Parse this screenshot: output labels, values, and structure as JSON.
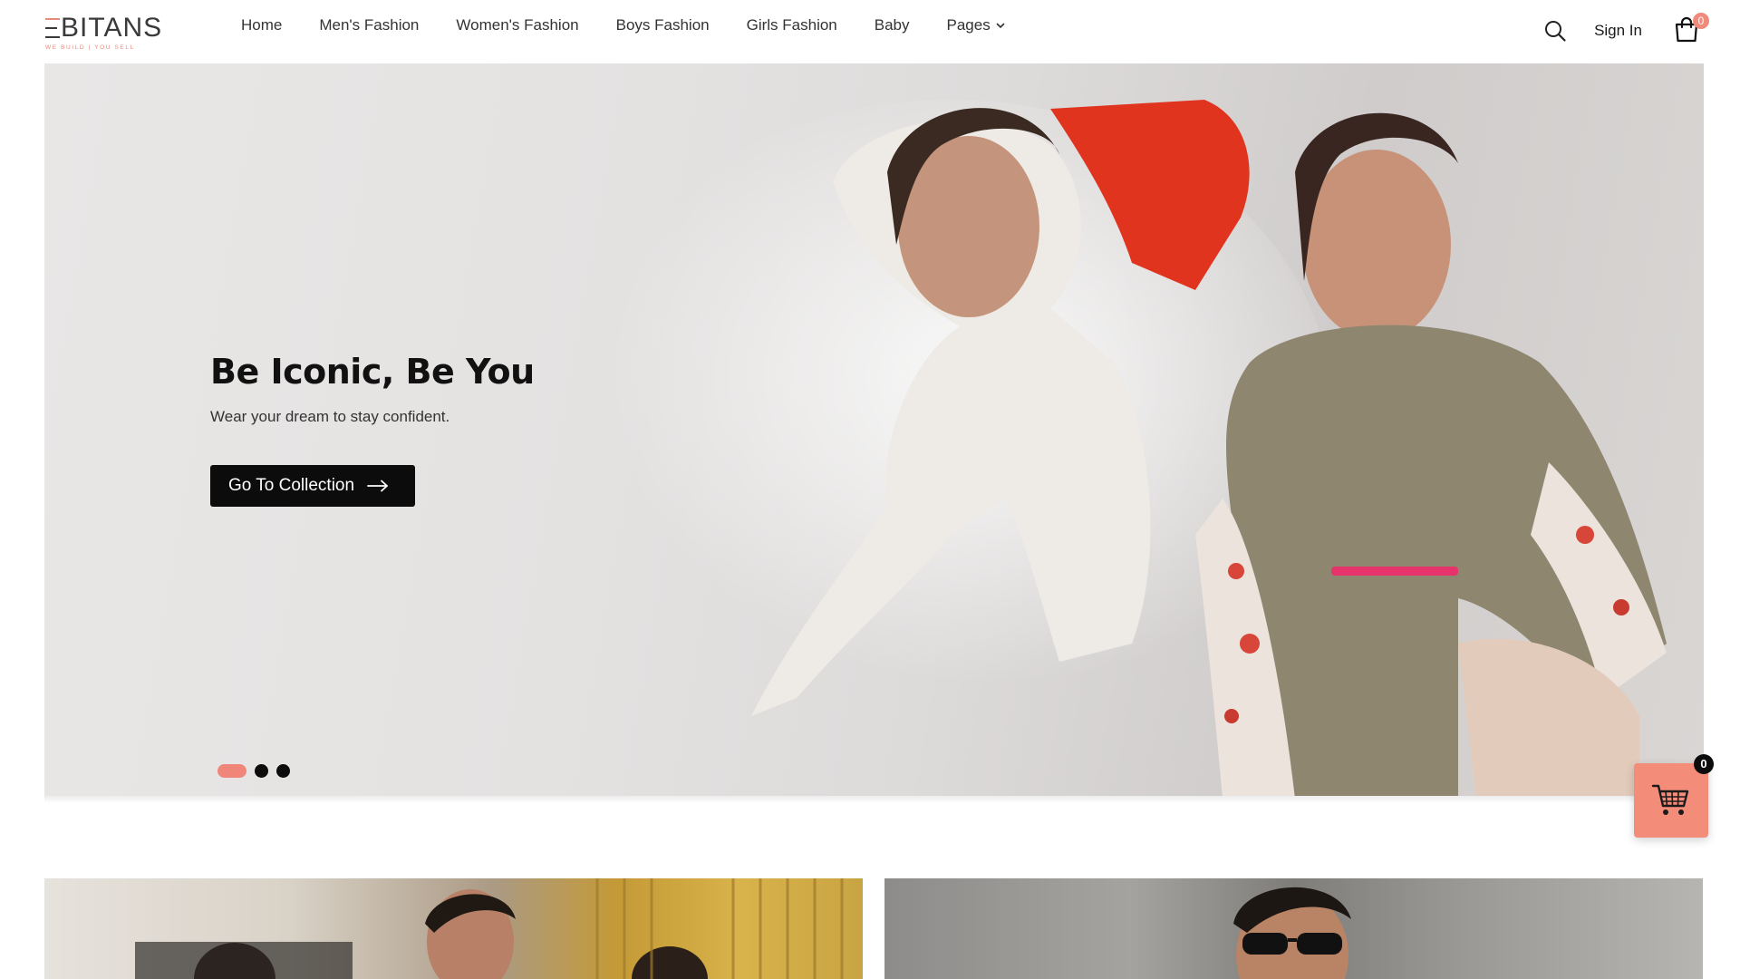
{
  "brand": {
    "name": "BITANS",
    "tagline": "WE BUILD | YOU SELL",
    "accent": "#f0867a"
  },
  "nav": {
    "items": [
      "Home",
      "Men's Fashion",
      "Women's Fashion",
      "Boys Fashion",
      "Girls Fashion",
      "Baby"
    ],
    "pages_label": "Pages"
  },
  "header": {
    "signin_label": "Sign In",
    "cart_count": "0"
  },
  "hero": {
    "title": "Be Iconic, Be You",
    "subtitle": "Wear your dream to stay confident.",
    "cta_label": "Go To Collection",
    "slides": 3,
    "active_slide": 1
  },
  "floating_cart": {
    "count": "0"
  },
  "icons": {
    "search": "search-icon",
    "cart": "shopping-bag-icon",
    "arrow": "arrow-right-icon",
    "chevron": "chevron-down-icon",
    "float_cart": "shopping-cart-icon"
  }
}
